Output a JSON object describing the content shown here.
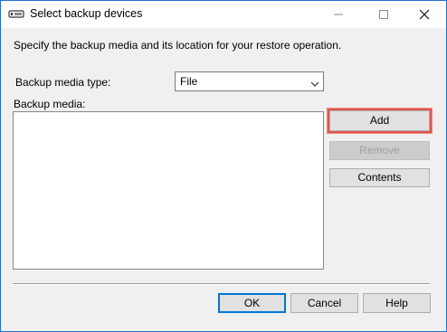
{
  "window": {
    "title": "Select backup devices",
    "icon": "backup-device-icon",
    "controls": {
      "minimize_icon": "minimize-icon",
      "maximize_icon": "maximize-icon",
      "close_icon": "close-icon"
    }
  },
  "instruction": "Specify the backup media and its location for your restore operation.",
  "media_type": {
    "label": "Backup media type:",
    "selected": "File"
  },
  "media_list": {
    "label": "Backup media:",
    "items": []
  },
  "side_buttons": {
    "add": "Add",
    "remove": "Remove",
    "contents": "Contents"
  },
  "footer_buttons": {
    "ok": "OK",
    "cancel": "Cancel",
    "help": "Help"
  },
  "colors": {
    "accent": "#0078d7",
    "highlight": "#e0554c",
    "disabled_text": "#a0a0a0"
  }
}
